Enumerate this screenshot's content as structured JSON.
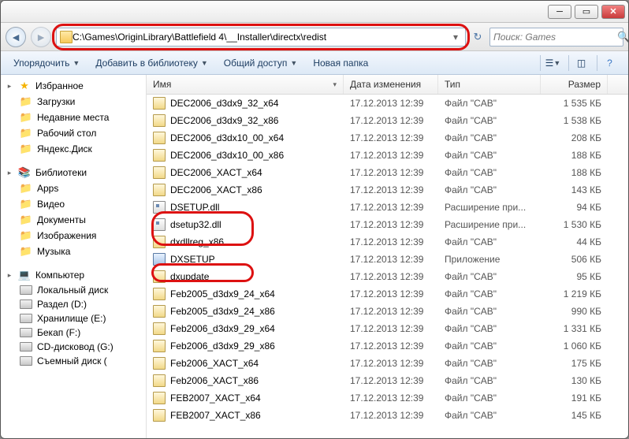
{
  "address": "C:\\Games\\OriginLibrary\\Battlefield 4\\__Installer\\directx\\redist",
  "search_placeholder": "Поиск: Games",
  "commandbar": {
    "organize": "Упорядочить",
    "include": "Добавить в библиотеку",
    "share": "Общий доступ",
    "newfolder": "Новая папка"
  },
  "columns": {
    "name": "Имя",
    "date": "Дата изменения",
    "type": "Тип",
    "size": "Размер"
  },
  "nav": {
    "fav": {
      "head": "Избранное",
      "items": [
        "Загрузки",
        "Недавние места",
        "Рабочий стол",
        "Яндекс.Диск"
      ]
    },
    "libs": {
      "head": "Библиотеки",
      "items": [
        "Apps",
        "Видео",
        "Документы",
        "Изображения",
        "Музыка"
      ]
    },
    "computer": {
      "head": "Компьютер",
      "items": [
        "Локальный диск",
        "Раздел (D:)",
        "Хранилище (E:)",
        "Бекап (F:)",
        "CD-дисковод (G:)",
        "Съемный диск ("
      ]
    }
  },
  "files": [
    {
      "name": "DEC2006_d3dx9_32_x64",
      "date": "17.12.2013 12:39",
      "type": "Файл \"CAB\"",
      "size": "1 535 КБ",
      "icon": "cab"
    },
    {
      "name": "DEC2006_d3dx9_32_x86",
      "date": "17.12.2013 12:39",
      "type": "Файл \"CAB\"",
      "size": "1 538 КБ",
      "icon": "cab"
    },
    {
      "name": "DEC2006_d3dx10_00_x64",
      "date": "17.12.2013 12:39",
      "type": "Файл \"CAB\"",
      "size": "208 КБ",
      "icon": "cab"
    },
    {
      "name": "DEC2006_d3dx10_00_x86",
      "date": "17.12.2013 12:39",
      "type": "Файл \"CAB\"",
      "size": "188 КБ",
      "icon": "cab"
    },
    {
      "name": "DEC2006_XACT_x64",
      "date": "17.12.2013 12:39",
      "type": "Файл \"CAB\"",
      "size": "188 КБ",
      "icon": "cab"
    },
    {
      "name": "DEC2006_XACT_x86",
      "date": "17.12.2013 12:39",
      "type": "Файл \"CAB\"",
      "size": "143 КБ",
      "icon": "cab"
    },
    {
      "name": "DSETUP.dll",
      "date": "17.12.2013 12:39",
      "type": "Расширение при...",
      "size": "94 КБ",
      "icon": "dll"
    },
    {
      "name": "dsetup32.dll",
      "date": "17.12.2013 12:39",
      "type": "Расширение при...",
      "size": "1 530 КБ",
      "icon": "dll"
    },
    {
      "name": "dxdllreg_x86",
      "date": "17.12.2013 12:39",
      "type": "Файл \"CAB\"",
      "size": "44 КБ",
      "icon": "cab"
    },
    {
      "name": "DXSETUP",
      "date": "17.12.2013 12:39",
      "type": "Приложение",
      "size": "506 КБ",
      "icon": "exe"
    },
    {
      "name": "dxupdate",
      "date": "17.12.2013 12:39",
      "type": "Файл \"CAB\"",
      "size": "95 КБ",
      "icon": "cab"
    },
    {
      "name": "Feb2005_d3dx9_24_x64",
      "date": "17.12.2013 12:39",
      "type": "Файл \"CAB\"",
      "size": "1 219 КБ",
      "icon": "cab"
    },
    {
      "name": "Feb2005_d3dx9_24_x86",
      "date": "17.12.2013 12:39",
      "type": "Файл \"CAB\"",
      "size": "990 КБ",
      "icon": "cab"
    },
    {
      "name": "Feb2006_d3dx9_29_x64",
      "date": "17.12.2013 12:39",
      "type": "Файл \"CAB\"",
      "size": "1 331 КБ",
      "icon": "cab"
    },
    {
      "name": "Feb2006_d3dx9_29_x86",
      "date": "17.12.2013 12:39",
      "type": "Файл \"CAB\"",
      "size": "1 060 КБ",
      "icon": "cab"
    },
    {
      "name": "Feb2006_XACT_x64",
      "date": "17.12.2013 12:39",
      "type": "Файл \"CAB\"",
      "size": "175 КБ",
      "icon": "cab"
    },
    {
      "name": "Feb2006_XACT_x86",
      "date": "17.12.2013 12:39",
      "type": "Файл \"CAB\"",
      "size": "130 КБ",
      "icon": "cab"
    },
    {
      "name": "FEB2007_XACT_x64",
      "date": "17.12.2013 12:39",
      "type": "Файл \"CAB\"",
      "size": "191 КБ",
      "icon": "cab"
    },
    {
      "name": "FEB2007_XACT_x86",
      "date": "17.12.2013 12:39",
      "type": "Файл \"CAB\"",
      "size": "145 КБ",
      "icon": "cab"
    }
  ]
}
